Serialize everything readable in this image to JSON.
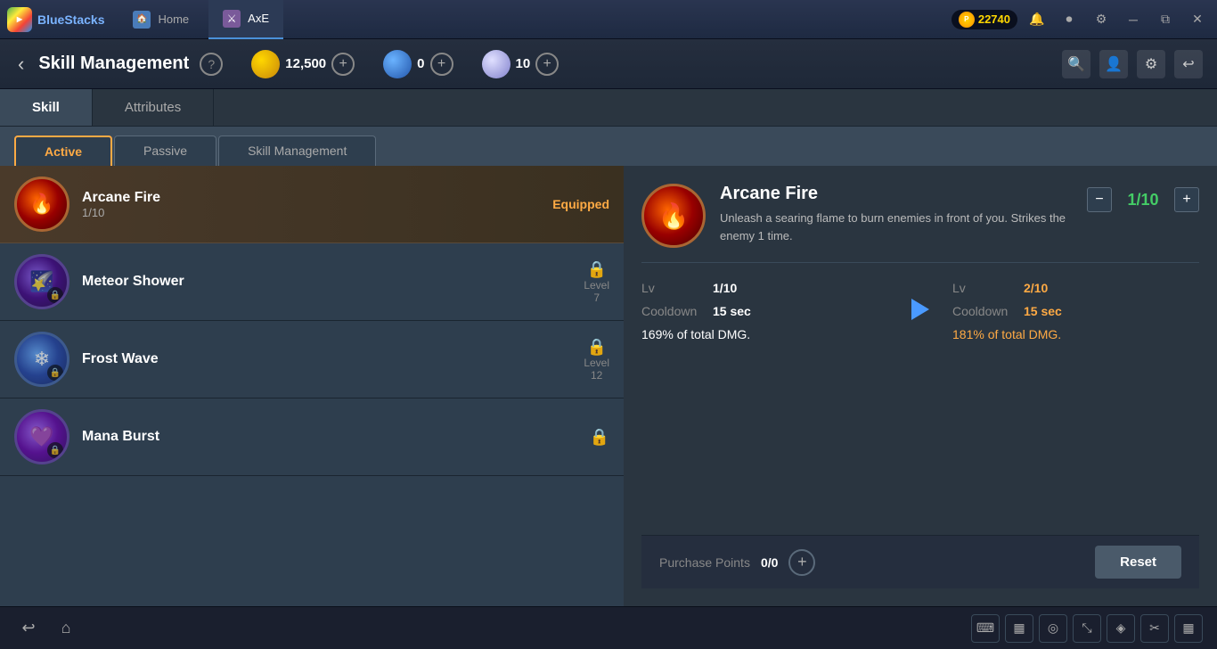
{
  "titleBar": {
    "brand": "BlueStacks",
    "coins": "22740",
    "tabs": [
      {
        "id": "home",
        "label": "Home",
        "active": false
      },
      {
        "id": "axe",
        "label": "AxE",
        "active": true
      }
    ],
    "buttons": [
      "minimize",
      "restore",
      "close"
    ]
  },
  "topBar": {
    "title": "Skill Management",
    "helpLabel": "?",
    "currency": [
      {
        "id": "gold",
        "value": "12,500"
      },
      {
        "id": "blue",
        "value": "0"
      },
      {
        "id": "white",
        "value": "10"
      }
    ]
  },
  "mainTabs": [
    {
      "id": "skill",
      "label": "Skill",
      "active": true
    },
    {
      "id": "attributes",
      "label": "Attributes",
      "active": false
    }
  ],
  "subTabs": [
    {
      "id": "active",
      "label": "Active",
      "active": true
    },
    {
      "id": "passive",
      "label": "Passive",
      "active": false
    },
    {
      "id": "skill-management",
      "label": "Skill Management",
      "active": false
    }
  ],
  "skillList": [
    {
      "id": "arcane-fire",
      "name": "Arcane Fire",
      "level": "1/10",
      "equipped": true,
      "equippedLabel": "Equipped",
      "locked": false,
      "selected": true,
      "type": "arcane"
    },
    {
      "id": "meteor-shower",
      "name": "Meteor Shower",
      "level": "7",
      "levelLabel": "Level",
      "equipped": false,
      "locked": true,
      "selected": false,
      "type": "meteor"
    },
    {
      "id": "frost-wave",
      "name": "Frost Wave",
      "level": "12",
      "levelLabel": "Level",
      "equipped": false,
      "locked": true,
      "selected": false,
      "type": "frost"
    },
    {
      "id": "mana-burst",
      "name": "Mana Burst",
      "level": "",
      "equipped": false,
      "locked": true,
      "selected": false,
      "type": "mana"
    }
  ],
  "skillDetail": {
    "name": "Arcane Fire",
    "description": "Unleash a searing flame to burn enemies in front of you. Strikes the enemy 1 time.",
    "currentLevel": "1/10",
    "nextLevel": "2/10",
    "stats": {
      "current": {
        "lv": "1/10",
        "cooldown": "15 sec",
        "dmg": "169% of total DMG."
      },
      "next": {
        "lv": "2/10",
        "cooldown": "15 sec",
        "dmg": "181% of total DMG."
      }
    },
    "labels": {
      "lv": "Lv",
      "cooldown": "Cooldown"
    }
  },
  "bottomBar": {
    "purchaseLabel": "Purchase Points",
    "purchaseValue": "0/0",
    "resetLabel": "Reset"
  },
  "taskbar": {
    "leftButtons": [
      "back",
      "home"
    ],
    "rightButtons": [
      "keyboard",
      "keyboard2",
      "camera",
      "expand",
      "location",
      "scissors",
      "grid"
    ]
  }
}
